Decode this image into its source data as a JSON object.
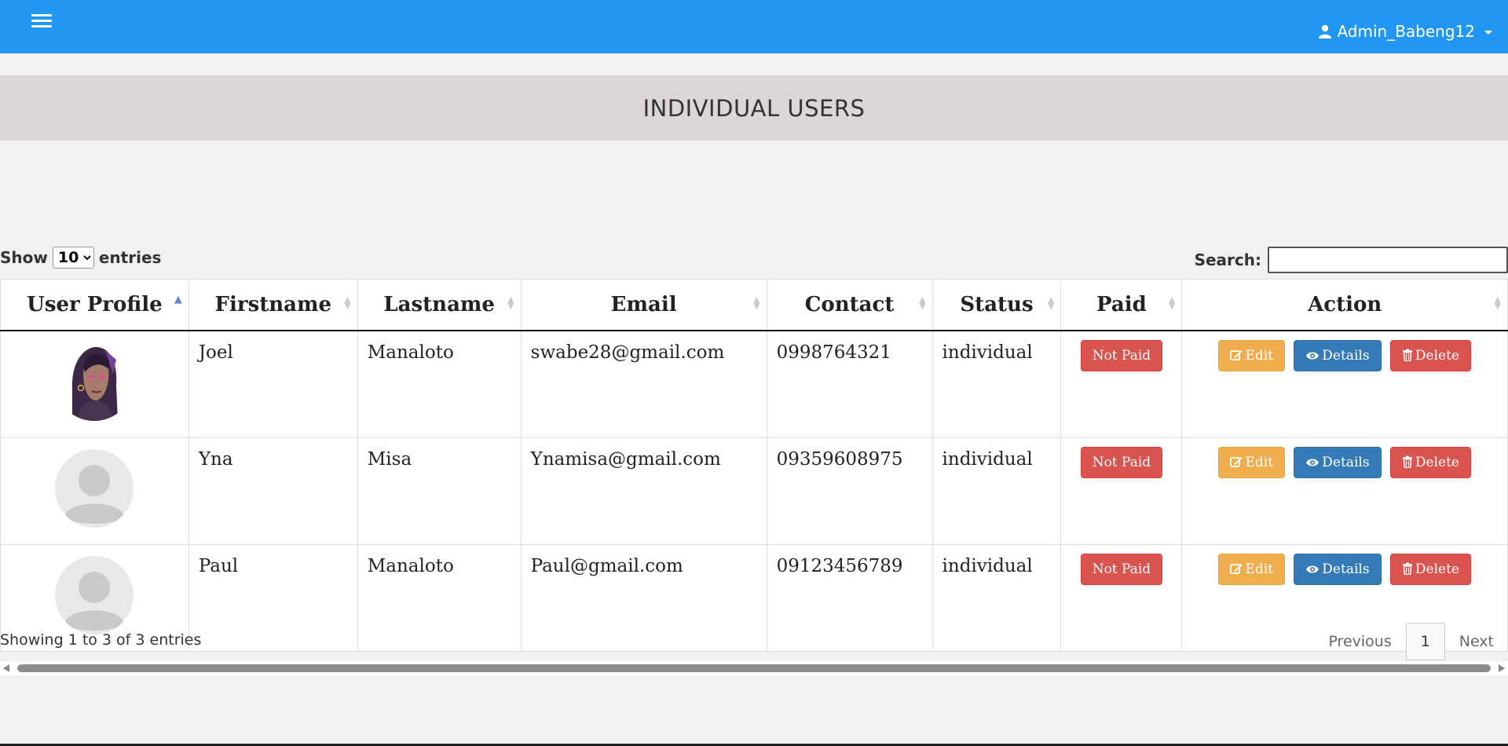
{
  "navbar": {
    "bg_color": "#2196f3",
    "menu_icon": "hamburger-icon",
    "user_icon": "user-icon",
    "username": "Admin_Babeng12"
  },
  "page": {
    "title": "INDIVIDUAL USERS"
  },
  "controls": {
    "show_label": "Show",
    "entries_label": "entries",
    "page_size": "10",
    "page_size_options": [
      "10"
    ],
    "search_label": "Search:",
    "search_value": ""
  },
  "table": {
    "columns": [
      "User Profile",
      "Firstname",
      "Lastname",
      "Email",
      "Contact",
      "Status",
      "Paid",
      "Action"
    ],
    "sorted_column": "User Profile",
    "sort_direction": "ascending",
    "rows": [
      {
        "avatar": "character-portrait",
        "firstname": "Joel",
        "lastname": "Manaloto",
        "email": "swabe28@gmail.com",
        "contact": "0998764321",
        "status": "individual",
        "paid": "Not Paid"
      },
      {
        "avatar": "default-avatar",
        "firstname": "Yna",
        "lastname": "Misa",
        "email": "Ynamisa@gmail.com",
        "contact": "09359608975",
        "status": "individual",
        "paid": "Not Paid"
      },
      {
        "avatar": "default-avatar",
        "firstname": "Paul",
        "lastname": "Manaloto",
        "email": "Paul@gmail.com",
        "contact": "09123456789",
        "status": "individual",
        "paid": "Not Paid"
      }
    ],
    "actions": {
      "edit": "Edit",
      "details": "Details",
      "delete": "Delete"
    },
    "colors": {
      "paid_badge": "#d9534f",
      "edit": "#f0ad4e",
      "details": "#337ab7",
      "delete": "#d9534f"
    }
  },
  "footer": {
    "info": "Showing 1 to 3 of 3 entries",
    "previous": "Previous",
    "current_page": "1",
    "next": "Next"
  }
}
